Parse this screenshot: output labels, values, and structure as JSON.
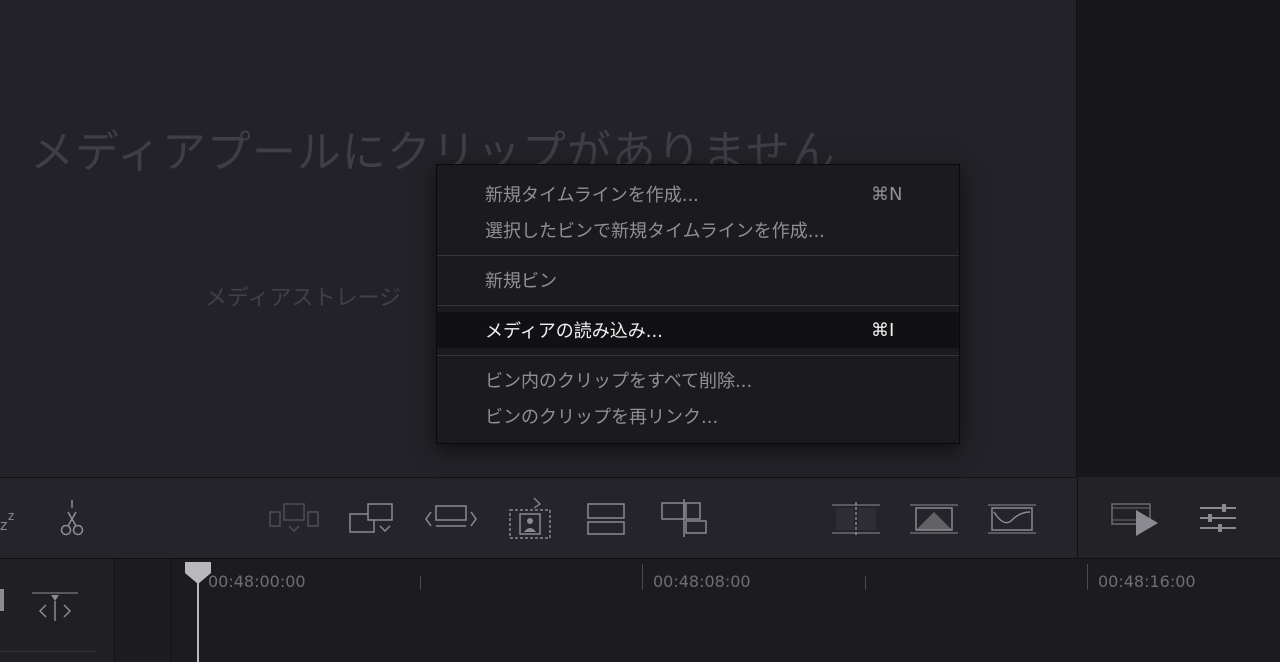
{
  "media_pool": {
    "empty_title": "メディアプールにクリップがありません",
    "empty_subtitle": "メディアストレージ"
  },
  "context_menu": {
    "items": [
      {
        "label": "新規タイムラインを作成...",
        "shortcut": "⌘N"
      },
      {
        "label": "選択したビンで新規タイムラインを作成...",
        "shortcut": ""
      },
      {
        "label": "新規ビン",
        "shortcut": ""
      },
      {
        "label": "メディアの読み込み...",
        "shortcut": "⌘I",
        "highlighted": true
      },
      {
        "label": "ビン内のクリップをすべて削除...",
        "shortcut": ""
      },
      {
        "label": "ビンのクリップを再リンク...",
        "shortcut": ""
      }
    ]
  },
  "toolbar": {
    "icons": [
      "sleep-z-icon",
      "scissors-icon",
      "insert-clip-icon",
      "overwrite-clip-icon",
      "replace-clip-icon",
      "fit-to-fill-icon",
      "place-on-top-icon",
      "ripple-overwrite-icon",
      "append-at-end-icon",
      "cut-transition-icon",
      "dissolve-transition-icon",
      "smooth-cut-icon",
      "playback-film-icon",
      "settings-sliders-icon"
    ]
  },
  "timeline": {
    "timecodes": [
      "00:48:00:00",
      "00:48:08:00",
      "00:48:16:00"
    ]
  },
  "colors": {
    "background": "#222228",
    "menu_background": "#1b1b1f",
    "menu_highlight": "#111113",
    "menu_text": "#8f8f95",
    "menu_text_highlight": "#f0f0f2"
  }
}
